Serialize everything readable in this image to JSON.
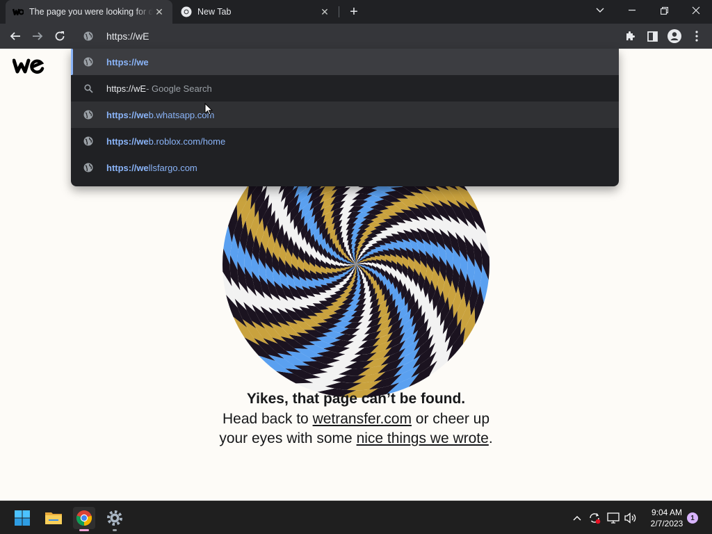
{
  "tabs": [
    {
      "title": "The page you were looking for d"
    },
    {
      "title": "New Tab"
    }
  ],
  "omnibox": {
    "value": "https://wE"
  },
  "suggestions": [
    {
      "match": "https://we",
      "rest": "",
      "kind": "url",
      "icon": "globe-icon"
    },
    {
      "match": "https://wE",
      "rest": " - Google Search",
      "kind": "search",
      "icon": "search-icon"
    },
    {
      "match": "https://we",
      "rest": "b.whatsapp.com",
      "kind": "url",
      "icon": "globe-icon"
    },
    {
      "match": "https://we",
      "rest": "b.roblox.com/home",
      "kind": "url",
      "icon": "globe-icon"
    },
    {
      "match": "https://we",
      "rest": "llsfargo.com",
      "kind": "url",
      "icon": "globe-icon"
    }
  ],
  "page": {
    "headline": "Yikes, that page can’t be found.",
    "line_pre": "Head back to ",
    "link1": "wetransfer.com",
    "line_mid": " or cheer up your eyes with some ",
    "link2": "nice things we wrote",
    "line_end": "."
  },
  "taskbar": {
    "time": "9:04 AM",
    "date": "2/7/2023",
    "notification_count": "1"
  },
  "colors": {
    "accent": "#8ab4f8",
    "page_bg": "#fdfbf7",
    "spiral_blue": "#5aa0f0",
    "spiral_gold": "#c9a23e",
    "spiral_dark": "#1b1320"
  }
}
